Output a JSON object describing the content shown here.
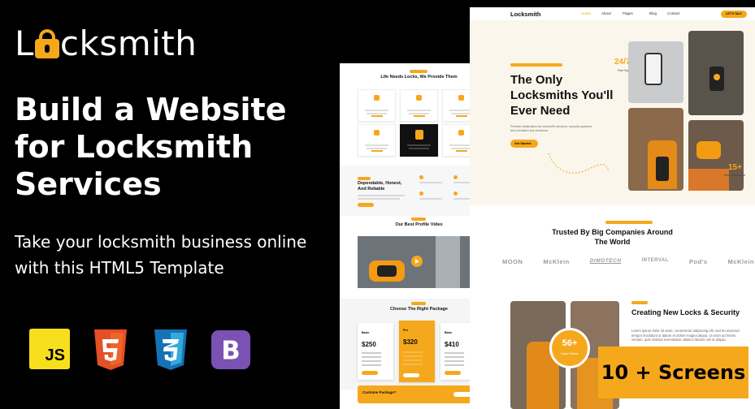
{
  "brand": {
    "logo_prefix": "L",
    "logo_suffix": "cksmith"
  },
  "headline": "Build a Website for Locksmith Services",
  "subheadline": "Take your locksmith business online with this HTML5 Template",
  "tech_badges": [
    "JS",
    "HTML5",
    "CSS3",
    "Bootstrap"
  ],
  "badge": "10 + Screens",
  "mockup_left": {
    "section1_title": "Life Needs Locks, We Provide Them",
    "section2_title": "Dependable, Honest, And Reliable",
    "section3_title": "Our Best Profile Video",
    "section4_title": "Choose The Right Package",
    "prices": [
      "$250",
      "$320",
      "$410"
    ],
    "package_names": [
      "Basic",
      "Pro",
      "Basic"
    ],
    "custom_package": "Custome Package?"
  },
  "mockup_right": {
    "brand": "Locksmith",
    "nav": [
      "Home",
      "About",
      "Pages",
      "Blog",
      "Contact"
    ],
    "hero_title": "The Only Locksmiths You'll Ever Need",
    "hero_text": "Premier destination for locksmith services, security systems, and precision key solutions.",
    "hero_button": "Get Started",
    "stat1": {
      "value": "24/7",
      "label": "Free Support"
    },
    "stat2": {
      "value": "15+",
      "label": "Years Experience"
    },
    "trusted_title": "Trusted By Big Companies Around The World",
    "companies": [
      "MOON",
      "McKlein",
      "DIMOTECH",
      "INTERVAL",
      "Pod's",
      "McKlein"
    ],
    "section3_title": "Creating New Locks & Security",
    "section3_text": "Lorem ipsum dolor sit amet, consectetur adipiscing elit, sed do eiusmod tempor incididunt ut labore et dolore magna aliqua. Ut enim ad minim veniam, quis nostrud exercitation ullamco laboris nisi ut aliquip.",
    "experts": {
      "value": "56+",
      "label": "Expert Teams"
    }
  },
  "colors": {
    "accent": "#f6a81c",
    "background": "#000000"
  }
}
